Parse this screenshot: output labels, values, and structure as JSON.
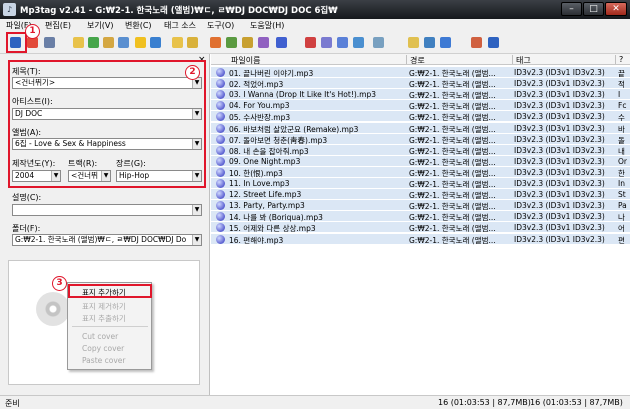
{
  "window": {
    "title": "Mp3tag v2.41  -  G:₩2-1. 한국노래 (앨범)₩ㄷ, ㄹ₩DJ DOC₩DJ DOC 6집₩",
    "min": "–",
    "max": "□",
    "close": "✕"
  },
  "menu": [
    "파일(F)",
    "편집(E)",
    "보기(V)",
    "변환(C)",
    "태그 소스",
    "도구(O)",
    "도움말(H)"
  ],
  "toolbar_colors": [
    "#2e62c0",
    "#e24a3a",
    "#6a7fa6",
    "#e8c24a",
    "#46a54a",
    "#d4a742",
    "#5a8fd0",
    "#f0c020",
    "#3a80d0",
    "#e8c24a",
    "#d9b13a",
    "#e07030",
    "#5a9a40",
    "#c8a030",
    "#9060c0",
    "#4060d0",
    "#d04040",
    "#7a7ad0",
    "#5a80d8",
    "#4a8fd0",
    "#78a0c0",
    "#e0c050",
    "#4080c0",
    "#3e7ad4",
    "#d06040",
    "#2e62c0"
  ],
  "badges": {
    "one": "1",
    "two": "2",
    "three": "3"
  },
  "panel": {
    "title_label": "제목(T):",
    "title_value": "<건너뛰기>",
    "artist_label": "아티스트(I):",
    "artist_value": "DJ DOC",
    "album_label": "앨범(A):",
    "album_value": "6집 - Love & Sex & Happiness",
    "year_label": "제작년도(Y):",
    "year_value": "2004",
    "track_label": "트랙(R):",
    "track_value": "<건너뛰",
    "genre_label": "장르(G):",
    "genre_value": "Hip-Hop",
    "comment_label": "설명(C):",
    "comment_value": "",
    "folder_label": "폴더(F):",
    "folder_value": "G:₩2-1. 한국노래 (앨범)₩ㄷ, ㄹ₩DJ DOC₩DJ Do",
    "close_x": "×"
  },
  "context_menu": {
    "items": [
      "표지 추가하기",
      "표지 제거하기",
      "표지 추출하기",
      "Cut cover",
      "Copy cover",
      "Paste cover"
    ]
  },
  "list": {
    "headers": [
      "파일이름",
      "경로",
      "태그",
      "?"
    ],
    "rows": [
      [
        "01. 끝나버린 이야기.mp3",
        "G:₩2-1. 한국노래 (앨범...",
        "ID3v2.3 (ID3v1 ID3v2.3)",
        "끝"
      ],
      [
        "02. 적었어.mp3",
        "G:₩2-1. 한국노래 (앨범...",
        "ID3v2.3 (ID3v1 ID3v2.3)",
        "적"
      ],
      [
        "03. I Wanna (Drop It Like It's Hot!).mp3",
        "G:₩2-1. 한국노래 (앨범...",
        "ID3v2.3 (ID3v1 ID3v2.3)",
        "I"
      ],
      [
        "04. For You.mp3",
        "G:₩2-1. 한국노래 (앨범...",
        "ID3v2.3 (ID3v1 ID3v2.3)",
        "Fc"
      ],
      [
        "05. 수사반장.mp3",
        "G:₩2-1. 한국노래 (앨범...",
        "ID3v2.3 (ID3v1 ID3v2.3)",
        "수"
      ],
      [
        "06. 바보처럼 살았군요 (Remake).mp3",
        "G:₩2-1. 한국노래 (앨범...",
        "ID3v2.3 (ID3v1 ID3v2.3)",
        "바"
      ],
      [
        "07. 돌아보면 청춘(靑春).mp3",
        "G:₩2-1. 한국노래 (앨범...",
        "ID3v2.3 (ID3v1 ID3v2.3)",
        "돌"
      ],
      [
        "08. 내 손을 잡아줘.mp3",
        "G:₩2-1. 한국노래 (앨범...",
        "ID3v2.3 (ID3v1 ID3v2.3)",
        "내"
      ],
      [
        "09. One Night.mp3",
        "G:₩2-1. 한국노래 (앨범...",
        "ID3v2.3 (ID3v1 ID3v2.3)",
        "Or"
      ],
      [
        "10. 한(恨).mp3",
        "G:₩2-1. 한국노래 (앨범...",
        "ID3v2.3 (ID3v1 ID3v2.3)",
        "한"
      ],
      [
        "11. In Love.mp3",
        "G:₩2-1. 한국노래 (앨범...",
        "ID3v2.3 (ID3v1 ID3v2.3)",
        "In"
      ],
      [
        "12. Street Life.mp3",
        "G:₩2-1. 한국노래 (앨범...",
        "ID3v2.3 (ID3v1 ID3v2.3)",
        "St"
      ],
      [
        "13. Party, Party.mp3",
        "G:₩2-1. 한국노래 (앨범...",
        "ID3v2.3 (ID3v1 ID3v2.3)",
        "Pa"
      ],
      [
        "14. 나를 봐 (Boriqua).mp3",
        "G:₩2-1. 한국노래 (앨범...",
        "ID3v2.3 (ID3v1 ID3v2.3)",
        "나"
      ],
      [
        "15. 어제와 다른 상상.mp3",
        "G:₩2-1. 한국노래 (앨범...",
        "ID3v2.3 (ID3v1 ID3v2.3)",
        "어"
      ],
      [
        "16. 편해야.mp3",
        "G:₩2-1. 한국노래 (앨범...",
        "ID3v2.3 (ID3v1 ID3v2.3)",
        "편"
      ]
    ]
  },
  "status": {
    "left": "준비",
    "sel": "16 (01:03:53 | 87,7MB)",
    "total": "16 (01:03:53 | 87,7MB)"
  }
}
